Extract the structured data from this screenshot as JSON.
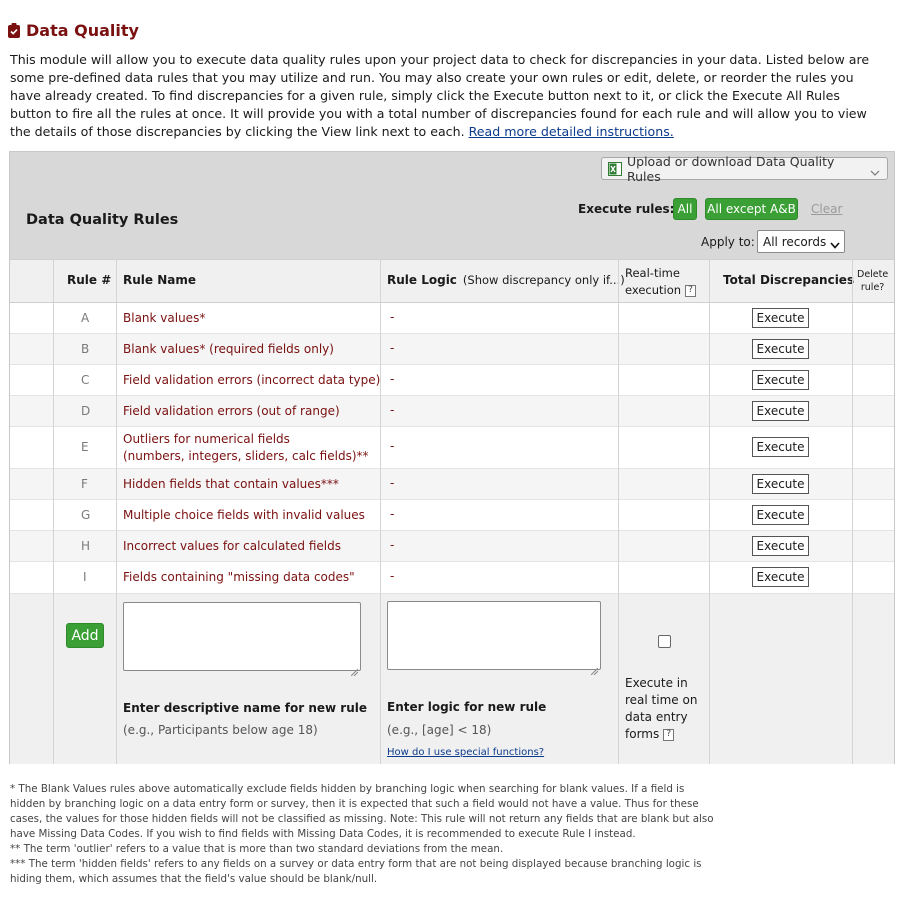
{
  "page": {
    "title": "Data Quality",
    "intro": "This module will allow you to execute data quality rules upon your project data to check for discrepancies in your data. Listed below are some pre-defined data rules that you may utilize and run. You may also create your own rules or edit, delete, or reorder the rules you have already created. To find discrepancies for a given rule, simply click the Execute button next to it, or click the Execute All Rules button to fire all the rules at once. It will provide you with a total number of discrepancies found for each rule and will allow you to view the details of those discrepancies by clicking the View link next to each.",
    "intro_link": "Read more detailed instructions."
  },
  "panel": {
    "title": "Data Quality Rules",
    "upload_label": "Upload or download Data Quality Rules",
    "execute_rules_label": "Execute rules:",
    "btn_all": "All",
    "btn_all_except": "All except A&B",
    "btn_clear": "Clear",
    "apply_to_label": "Apply to:",
    "apply_to_value": "All records"
  },
  "table": {
    "headers": {
      "rule_num": "Rule #",
      "rule_name": "Rule Name",
      "rule_logic": "Rule Logic",
      "rule_logic_sub": "(Show discrepancy only if...)",
      "realtime_1": "Real-time",
      "realtime_2": "execution",
      "help": "?",
      "total": "Total Discrepancies",
      "delete_1": "Delete",
      "delete_2": "rule?"
    },
    "rules": [
      {
        "id": "A",
        "name": "Blank values*",
        "logic": "-",
        "action": "Execute"
      },
      {
        "id": "B",
        "name": "Blank values* (required fields only)",
        "logic": "-",
        "action": "Execute"
      },
      {
        "id": "C",
        "name": "Field validation errors (incorrect data type)",
        "logic": "-",
        "action": "Execute"
      },
      {
        "id": "D",
        "name": "Field validation errors (out of range)",
        "logic": "-",
        "action": "Execute"
      },
      {
        "id": "E",
        "name": "Outliers for numerical fields",
        "name2": "(numbers, integers, sliders, calc fields)**",
        "logic": "-",
        "action": "Execute"
      },
      {
        "id": "F",
        "name": "Hidden fields that contain values***",
        "logic": "-",
        "action": "Execute"
      },
      {
        "id": "G",
        "name": "Multiple choice fields with invalid values",
        "logic": "-",
        "action": "Execute"
      },
      {
        "id": "H",
        "name": "Incorrect values for calculated fields",
        "logic": "-",
        "action": "Execute"
      },
      {
        "id": "I",
        "name": "Fields containing \"missing data codes\"",
        "logic": "-",
        "action": "Execute"
      }
    ],
    "new_rule": {
      "add_label": "Add",
      "name_label": "Enter descriptive name for new rule",
      "name_example": "(e.g., Participants below age 18)",
      "logic_label": "Enter logic for new rule",
      "logic_example": "(e.g., [age] < 18)",
      "help_link": "How do I use special functions?",
      "realtime_1": "Execute in",
      "realtime_2": "real time on",
      "realtime_3": "data entry",
      "realtime_4": "forms",
      "realtime_checked": false
    }
  },
  "footnotes": [
    "* The Blank Values rules above automatically exclude fields hidden by branching logic when searching for blank values. If a field is hidden by branching logic on a data entry form or survey, then it is expected that such a field would not have a value. Thus for these cases, the values for those hidden fields will not be classified as missing. Note: This rule will not return any fields that are blank but also have Missing Data Codes. If you wish to find fields with Missing Data Codes, it is recommended to execute Rule I instead.",
    "** The term 'outlier' refers to a value that is more than two standard deviations from the mean.",
    "*** The term 'hidden fields' refers to any fields on a survey or data entry form that are not being displayed because branching logic is hiding them, which assumes that the field's value should be blank/null."
  ],
  "colors": {
    "accent": "#7a1010",
    "green": "#3aa035",
    "link": "#0b3b8c"
  }
}
